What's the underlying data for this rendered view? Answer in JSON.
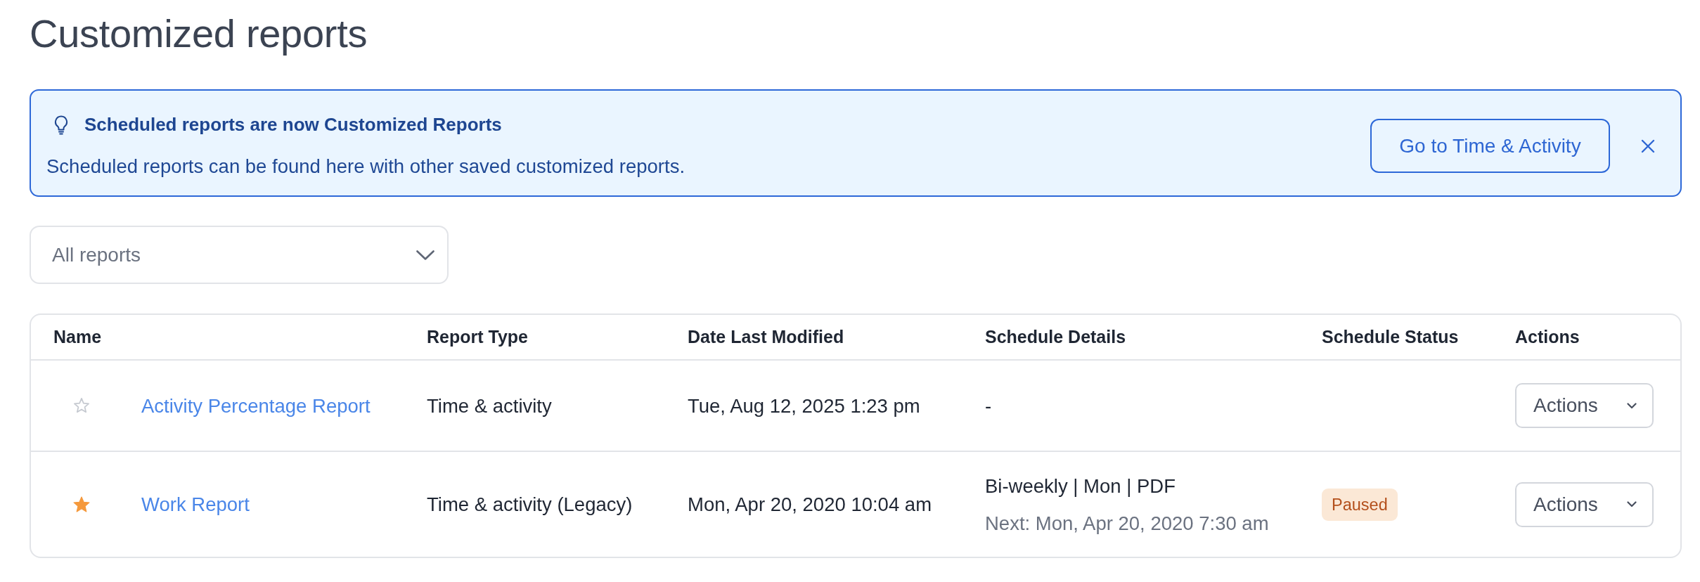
{
  "page": {
    "title": "Customized reports"
  },
  "banner": {
    "title": "Scheduled reports are now Customized Reports",
    "message": "Scheduled reports can be found here with other saved customized reports.",
    "button": "Go to Time & Activity"
  },
  "filter": {
    "value": "All reports"
  },
  "table": {
    "columns": [
      "Name",
      "Report Type",
      "Date Last Modified",
      "Schedule Details",
      "Schedule Status",
      "Actions"
    ],
    "rows": [
      {
        "starred": false,
        "name": "Activity Percentage Report",
        "report_type": "Time & activity",
        "date_last_modified": "Tue, Aug 12, 2025 1:23 pm",
        "schedule_details": "-",
        "actions": "Actions"
      },
      {
        "starred": true,
        "name": "Work Report",
        "report_type": "Time & activity (Legacy)",
        "date_last_modified": "Mon, Apr 20, 2020 10:04 am",
        "schedule_details": "Bi-weekly | Mon | PDF",
        "schedule_next": "Next: Mon, Apr 20, 2020 7:30 am",
        "schedule_status": {
          "label": "Paused",
          "kind": "paused"
        },
        "actions": "Actions"
      }
    ]
  }
}
